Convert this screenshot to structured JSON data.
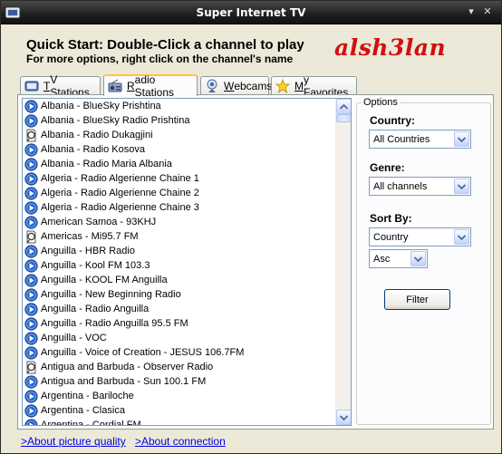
{
  "window": {
    "title": "Super Internet TV",
    "minimize_glyph": "▾",
    "close_glyph": "✕"
  },
  "header": {
    "quick_start": "Quick Start: Double-Click a channel to play",
    "more_options": "For more options, right click on the channel's name",
    "logo_text": "alsh3lan"
  },
  "tabs": [
    {
      "label_underlined": "T",
      "label_rest": "V Stations",
      "icon": "tv-icon",
      "active": false
    },
    {
      "label_underlined": "R",
      "label_rest": "adio Stations",
      "icon": "radio-icon",
      "active": true
    },
    {
      "label_underlined": "W",
      "label_rest": "ebcams",
      "icon": "webcam-icon",
      "active": false
    },
    {
      "label_underlined": "M",
      "label_rest": "y Favorites",
      "icon": "star-icon",
      "active": false
    }
  ],
  "stations": [
    {
      "name": "Albania - BlueSky Prishtina",
      "icon": "windows-media-icon"
    },
    {
      "name": "Albania - BlueSky Radio Prishtina",
      "icon": "windows-media-icon"
    },
    {
      "name": "Albania - Radio Dukagjini",
      "icon": "unknown-format-icon"
    },
    {
      "name": "Albania - Radio Kosova",
      "icon": "windows-media-icon"
    },
    {
      "name": "Albania - Radio Maria Albania",
      "icon": "windows-media-icon"
    },
    {
      "name": "Algeria - Radio Algerienne Chaine 1",
      "icon": "windows-media-icon"
    },
    {
      "name": "Algeria - Radio Algerienne Chaine 2",
      "icon": "windows-media-icon"
    },
    {
      "name": "Algeria - Radio Algerienne Chaine 3",
      "icon": "windows-media-icon"
    },
    {
      "name": "American Samoa - 93KHJ",
      "icon": "windows-media-icon"
    },
    {
      "name": "Americas - Mi95.7 FM",
      "icon": "unknown-format-icon"
    },
    {
      "name": "Anguilla - HBR Radio",
      "icon": "windows-media-icon"
    },
    {
      "name": "Anguilla - Kool FM 103.3",
      "icon": "windows-media-icon"
    },
    {
      "name": "Anguilla - KOOL FM Anguilla",
      "icon": "windows-media-icon"
    },
    {
      "name": "Anguilla - New Beginning Radio",
      "icon": "windows-media-icon"
    },
    {
      "name": "Anguilla - Radio Anguilla",
      "icon": "windows-media-icon"
    },
    {
      "name": "Anguilla - Radio Anguilla 95.5 FM",
      "icon": "windows-media-icon"
    },
    {
      "name": "Anguilla - VOC",
      "icon": "windows-media-icon"
    },
    {
      "name": "Anguilla - Voice of Creation - JESUS 106.7FM",
      "icon": "windows-media-icon"
    },
    {
      "name": "Antigua and Barbuda - Observer Radio",
      "icon": "unknown-format-icon"
    },
    {
      "name": "Antigua and Barbuda - Sun 100.1 FM",
      "icon": "windows-media-icon"
    },
    {
      "name": "Argentina - Bariloche",
      "icon": "windows-media-icon"
    },
    {
      "name": "Argentina - Clasica",
      "icon": "windows-media-icon"
    },
    {
      "name": "Argentina - Cordial FM",
      "icon": "windows-media-icon"
    }
  ],
  "options": {
    "legend": "Options",
    "country_label": "Country:",
    "country_value": "All Countries",
    "genre_label": "Genre:",
    "genre_value": "All channels",
    "sort_label": "Sort By:",
    "sort_value": "Country",
    "order_value": "Asc",
    "filter_label": "Filter"
  },
  "footer": {
    "picture_quality": ">About picture quality",
    "connection": ">About connection"
  },
  "colors": {
    "titlebar": "#1f1f1f",
    "face": "#ece9d8",
    "active_tab_accent": "#ffc83c",
    "logo": "#d01010",
    "link": "#0000e0"
  }
}
